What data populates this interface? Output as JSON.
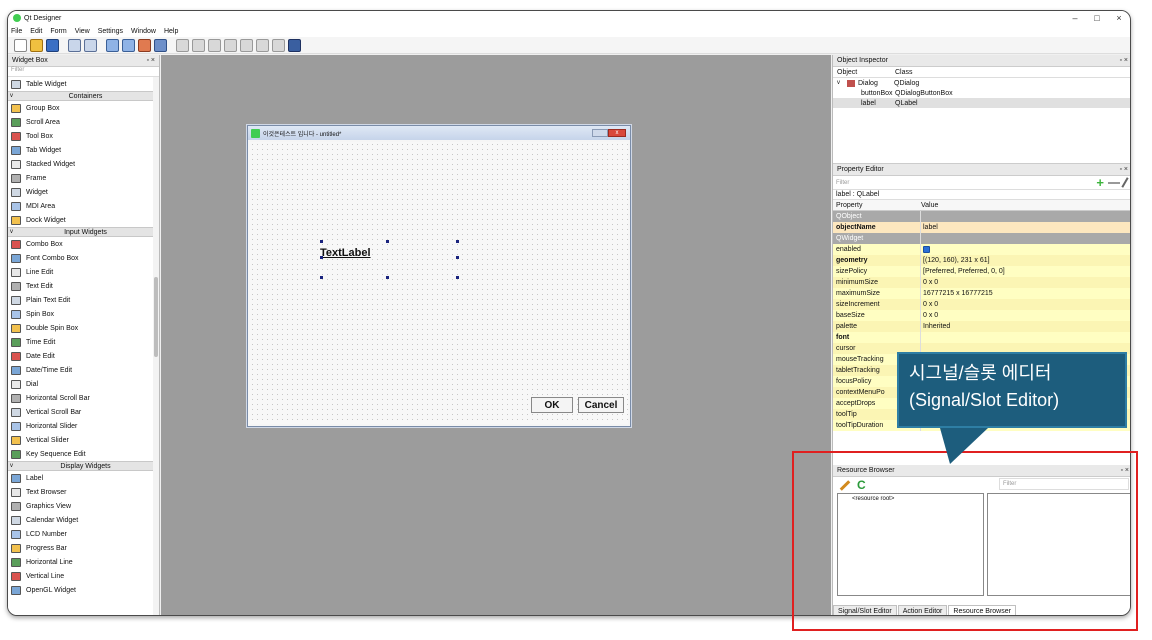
{
  "window": {
    "title": "Qt Designer",
    "controls": [
      "–",
      "□",
      "×"
    ]
  },
  "menu": [
    "File",
    "Edit",
    "Form",
    "View",
    "Settings",
    "Window",
    "Help"
  ],
  "widget_box": {
    "title": "Widget Box",
    "controls": "▫ ×",
    "filter_placeholder": "Filter",
    "items": [
      {
        "label": "Table Widget",
        "cat": false
      },
      {
        "label": "Containers",
        "cat": true
      },
      {
        "label": "Group Box",
        "cat": false
      },
      {
        "label": "Scroll Area",
        "cat": false
      },
      {
        "label": "Tool Box",
        "cat": false
      },
      {
        "label": "Tab Widget",
        "cat": false
      },
      {
        "label": "Stacked Widget",
        "cat": false
      },
      {
        "label": "Frame",
        "cat": false
      },
      {
        "label": "Widget",
        "cat": false
      },
      {
        "label": "MDI Area",
        "cat": false
      },
      {
        "label": "Dock Widget",
        "cat": false
      },
      {
        "label": "Input Widgets",
        "cat": true
      },
      {
        "label": "Combo Box",
        "cat": false
      },
      {
        "label": "Font Combo Box",
        "cat": false
      },
      {
        "label": "Line Edit",
        "cat": false
      },
      {
        "label": "Text Edit",
        "cat": false
      },
      {
        "label": "Plain Text Edit",
        "cat": false
      },
      {
        "label": "Spin Box",
        "cat": false
      },
      {
        "label": "Double Spin Box",
        "cat": false
      },
      {
        "label": "Time Edit",
        "cat": false
      },
      {
        "label": "Date Edit",
        "cat": false
      },
      {
        "label": "Date/Time Edit",
        "cat": false
      },
      {
        "label": "Dial",
        "cat": false
      },
      {
        "label": "Horizontal Scroll Bar",
        "cat": false
      },
      {
        "label": "Vertical Scroll Bar",
        "cat": false
      },
      {
        "label": "Horizontal Slider",
        "cat": false
      },
      {
        "label": "Vertical Slider",
        "cat": false
      },
      {
        "label": "Key Sequence Edit",
        "cat": false
      },
      {
        "label": "Display Widgets",
        "cat": true
      },
      {
        "label": "Label",
        "cat": false
      },
      {
        "label": "Text Browser",
        "cat": false
      },
      {
        "label": "Graphics View",
        "cat": false
      },
      {
        "label": "Calendar Widget",
        "cat": false
      },
      {
        "label": "LCD Number",
        "cat": false
      },
      {
        "label": "Progress Bar",
        "cat": false
      },
      {
        "label": "Horizontal Line",
        "cat": false
      },
      {
        "label": "Vertical Line",
        "cat": false
      },
      {
        "label": "OpenGL Widget",
        "cat": false
      }
    ]
  },
  "dialog": {
    "title": "이것은테스트 입니다 - untitled*",
    "label_text": "TextLabel",
    "ok_label": "OK",
    "cancel_label": "Cancel"
  },
  "object_inspector": {
    "title": "Object Inspector",
    "col_object": "Object",
    "col_class": "Class",
    "rows": [
      {
        "object": "Dialog",
        "class": "QDialog"
      },
      {
        "object": "buttonBox",
        "class": "QDialogButtonBox"
      },
      {
        "object": "label",
        "class": "QLabel"
      }
    ]
  },
  "property_editor": {
    "title": "Property Editor",
    "filter_placeholder": "Filter",
    "object_label": "label : QLabel",
    "col_property": "Property",
    "col_value": "Value",
    "rows": [
      {
        "name": "QObject",
        "value": "",
        "kind": "cat"
      },
      {
        "name": "objectName",
        "value": "label",
        "kind": "o"
      },
      {
        "name": "QWidget",
        "value": "",
        "kind": "cat"
      },
      {
        "name": "enabled",
        "value": "",
        "kind": "y"
      },
      {
        "name": "geometry",
        "value": "[(120, 160), 231 x 61]",
        "kind": "y2"
      },
      {
        "name": "sizePolicy",
        "value": "[Preferred, Preferred, 0, 0]",
        "kind": "y"
      },
      {
        "name": "minimumSize",
        "value": "0 x 0",
        "kind": "y2"
      },
      {
        "name": "maximumSize",
        "value": "16777215 x 16777215",
        "kind": "y"
      },
      {
        "name": "sizeIncrement",
        "value": "0 x 0",
        "kind": "y2"
      },
      {
        "name": "baseSize",
        "value": "0 x 0",
        "kind": "y"
      },
      {
        "name": "palette",
        "value": "Inherited",
        "kind": "y2"
      },
      {
        "name": "font",
        "value": "",
        "kind": "y"
      },
      {
        "name": "cursor",
        "value": "",
        "kind": "y2"
      },
      {
        "name": "mouseTracking",
        "value": "",
        "kind": "y"
      },
      {
        "name": "tabletTracking",
        "value": "",
        "kind": "y2"
      },
      {
        "name": "focusPolicy",
        "value": "",
        "kind": "y"
      },
      {
        "name": "contextMenuPo",
        "value": "",
        "kind": "y2"
      },
      {
        "name": "acceptDrops",
        "value": "",
        "kind": "y"
      },
      {
        "name": "toolTip",
        "value": "",
        "kind": "y2"
      },
      {
        "name": "toolTipDuration",
        "value": "-1",
        "kind": "y"
      }
    ]
  },
  "resource_browser": {
    "title": "Resource Browser",
    "filter_placeholder": "Filter",
    "root": "<resource root>",
    "tabs": [
      "Signal/Slot Editor",
      "Action Editor",
      "Resource Browser"
    ]
  },
  "callout": {
    "line1": "시그널/슬롯 에디터",
    "line2": "(Signal/Slot Editor)"
  },
  "colors": {
    "highlight": "#e02020",
    "callout_bg": "#1d5d7d"
  }
}
